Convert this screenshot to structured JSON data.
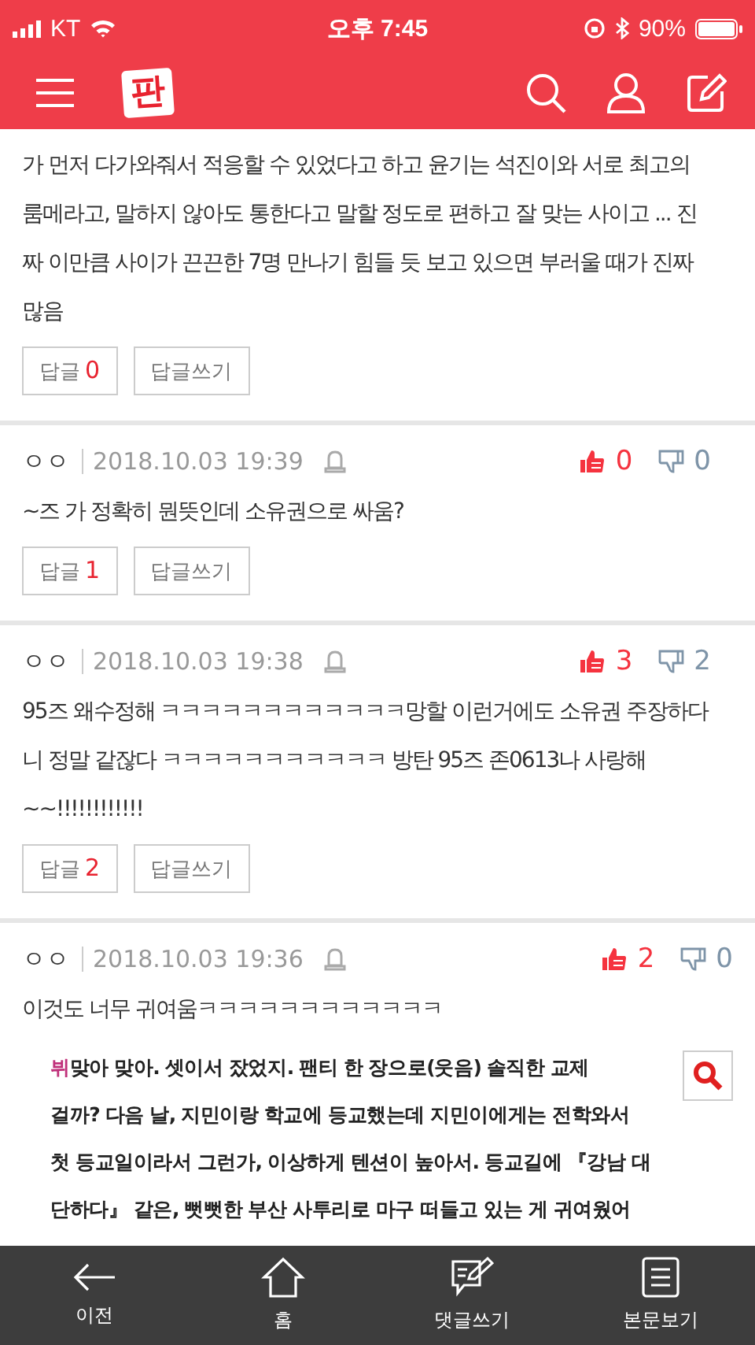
{
  "status_bar": {
    "carrier": "KT",
    "time": "오후 7:45",
    "battery": "90%"
  },
  "header": {
    "logo": "판"
  },
  "comments": [
    {
      "text": "가 먼저 다가와줘서 적응할 수 있었다고 하고 윤기는 석진이와 서로 최고의 룸메라고, 말하지 않아도 통한다고 말할 정도로 편하고 잘 맞는 사이고 ... 진짜 이만큼 사이가 끈끈한 7명 만나기 힘들 듯 보고 있으면 부러울 때가 진짜 많음",
      "reply_label": "답글",
      "reply_count": "0",
      "write_reply": "답글쓰기"
    },
    {
      "author": "ㅇㅇ",
      "date": "2018.10.03 19:39",
      "likes": "0",
      "dislikes": "0",
      "text": "~즈 가 정확히 뭔뜻인데 소유권으로 싸움?",
      "reply_label": "답글",
      "reply_count": "1",
      "write_reply": "답글쓰기"
    },
    {
      "author": "ㅇㅇ",
      "date": "2018.10.03 19:38",
      "likes": "3",
      "dislikes": "2",
      "text": "95즈 왜수정해 ㅋㅋㅋㅋㅋㅋㅋㅋㅋㅋㅋㅋ망할 이런거에도 소유권 주장하다니 정말 같잖다 ㅋㅋㅋㅋㅋㅋㅋㅋㅋㅋㅋ 방탄 95즈 존0613나 사랑해~~!!!!!!!!!!!!",
      "reply_label": "답글",
      "reply_count": "2",
      "write_reply": "답글쓰기"
    },
    {
      "author": "ㅇㅇ",
      "date": "2018.10.03 19:36",
      "likes": "2",
      "dislikes": "0",
      "text": "이것도 너무 귀여움ㅋㅋㅋㅋㅋㅋㅋㅋㅋㅋㅋㅋ",
      "quote": {
        "speaker": "뷔",
        "lines": [
          "맞아 맞아. 셋이서 잤었지. 팬티 한 장으로(웃음) 솔직한 교제",
          "걸까? 다음 날, 지민이랑 학교에 등교했는데 지민이에게는 전학와서",
          "첫 등교일이라서 그런가, 이상하게 텐션이 높아서. 등교길에 『강남 대",
          "단하다』 같은, 뻣뻣한 부산 사투리로 마구 떠들고 있는 게 귀여웠어"
        ]
      }
    }
  ],
  "bottom_nav": [
    {
      "label": "이전",
      "kind": "back"
    },
    {
      "label": "홈",
      "kind": "home"
    },
    {
      "label": "댓글쓰기",
      "kind": "write"
    },
    {
      "label": "본문보기",
      "kind": "article"
    }
  ]
}
